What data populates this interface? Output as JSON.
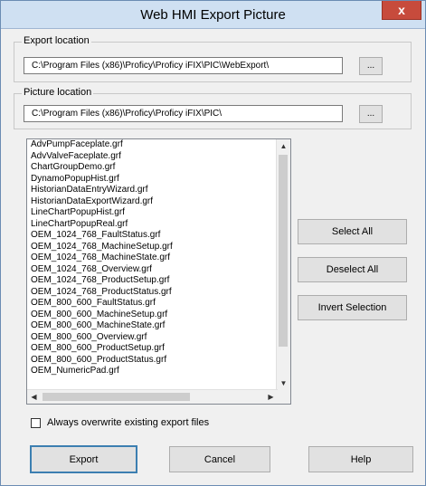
{
  "window": {
    "title": "Web HMI Export Picture",
    "close_label": "x"
  },
  "export_location": {
    "label": "Export location",
    "path": "C:\\Program Files (x86)\\Proficy\\Proficy iFIX\\PIC\\WebExport\\",
    "browse_label": "..."
  },
  "picture_location": {
    "label": "Picture location",
    "path": "C:\\Program Files (x86)\\Proficy\\Proficy iFIX\\PIC\\",
    "browse_label": "..."
  },
  "files": [
    "AdvPumpFaceplate.grf",
    "AdvValveFaceplate.grf",
    "ChartGroupDemo.grf",
    "DynamoPopupHist.grf",
    "HistorianDataEntryWizard.grf",
    "HistorianDataExportWizard.grf",
    "LineChartPopupHist.grf",
    "LineChartPopupReal.grf",
    "OEM_1024_768_FaultStatus.grf",
    "OEM_1024_768_MachineSetup.grf",
    "OEM_1024_768_MachineState.grf",
    "OEM_1024_768_Overview.grf",
    "OEM_1024_768_ProductSetup.grf",
    "OEM_1024_768_ProductStatus.grf",
    "OEM_800_600_FaultStatus.grf",
    "OEM_800_600_MachineSetup.grf",
    "OEM_800_600_MachineState.grf",
    "OEM_800_600_Overview.grf",
    "OEM_800_600_ProductSetup.grf",
    "OEM_800_600_ProductStatus.grf",
    "OEM_NumericPad.grf"
  ],
  "side_buttons": {
    "select_all": "Select All",
    "deselect_all": "Deselect All",
    "invert_selection": "Invert Selection"
  },
  "overwrite": {
    "label": "Always overwrite existing export files",
    "checked": false
  },
  "footer_buttons": {
    "export": "Export",
    "cancel": "Cancel",
    "help": "Help"
  },
  "icons": {
    "scroll_up": "▲",
    "scroll_down": "▼",
    "scroll_left": "◀",
    "scroll_right": "▶"
  }
}
